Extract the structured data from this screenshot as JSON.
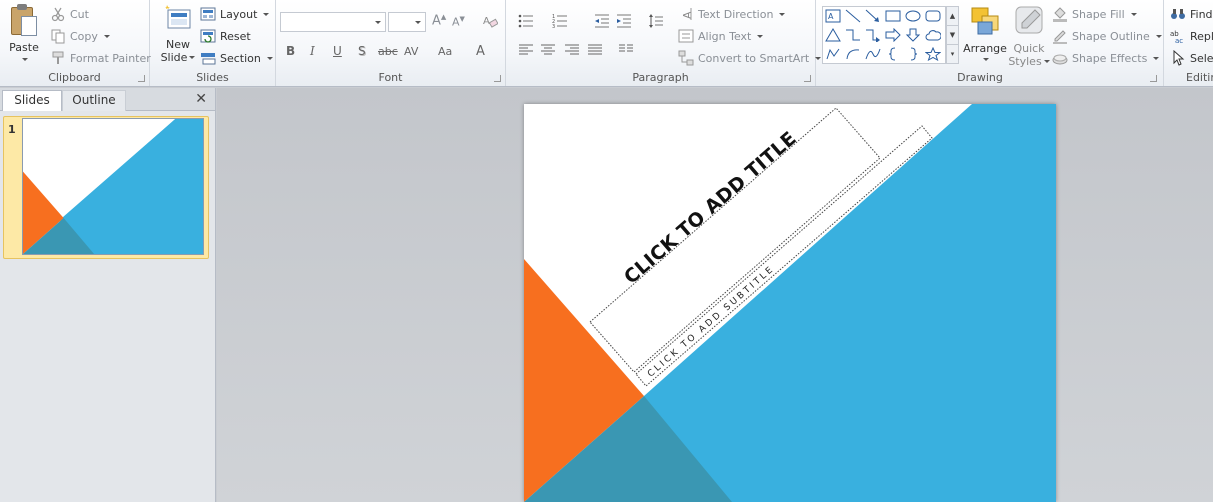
{
  "ribbon": {
    "clipboard": {
      "label": "Clipboard",
      "paste": "Paste",
      "cut": "Cut",
      "copy": "Copy",
      "format_painter": "Format Painter"
    },
    "slides": {
      "label": "Slides",
      "new_slide_line1": "New",
      "new_slide_line2": "Slide",
      "layout": "Layout",
      "reset": "Reset",
      "section": "Section"
    },
    "font": {
      "label": "Font",
      "font_name_value": "",
      "font_size_value": "",
      "bold": "B",
      "italic": "I",
      "underline": "U",
      "shadow": "S",
      "strikethrough": "abc",
      "spacing": "AV",
      "case": "Aa",
      "color": "A"
    },
    "paragraph": {
      "label": "Paragraph",
      "text_direction": "Text Direction",
      "align_text": "Align Text",
      "convert_smartart": "Convert to SmartArt"
    },
    "drawing": {
      "label": "Drawing",
      "arrange": "Arrange",
      "quick_styles_line1": "Quick",
      "quick_styles_line2": "Styles",
      "shape_fill": "Shape Fill",
      "shape_outline": "Shape Outline",
      "shape_effects": "Shape Effects"
    },
    "editing": {
      "label": "Editin",
      "find": "Find",
      "replace": "Repl",
      "select": "Sele"
    }
  },
  "left_panel": {
    "tab_slides": "Slides",
    "tab_outline": "Outline",
    "close": "✕",
    "slide_number": "1"
  },
  "slide": {
    "title_placeholder": "CLICK TO ADD TITLE",
    "subtitle_placeholder": "CLICK TO ADD SUBTITLE"
  },
  "colors": {
    "orange": "#f76f1f",
    "blue": "#39b0df",
    "dark_teal": "#3a97b3"
  }
}
